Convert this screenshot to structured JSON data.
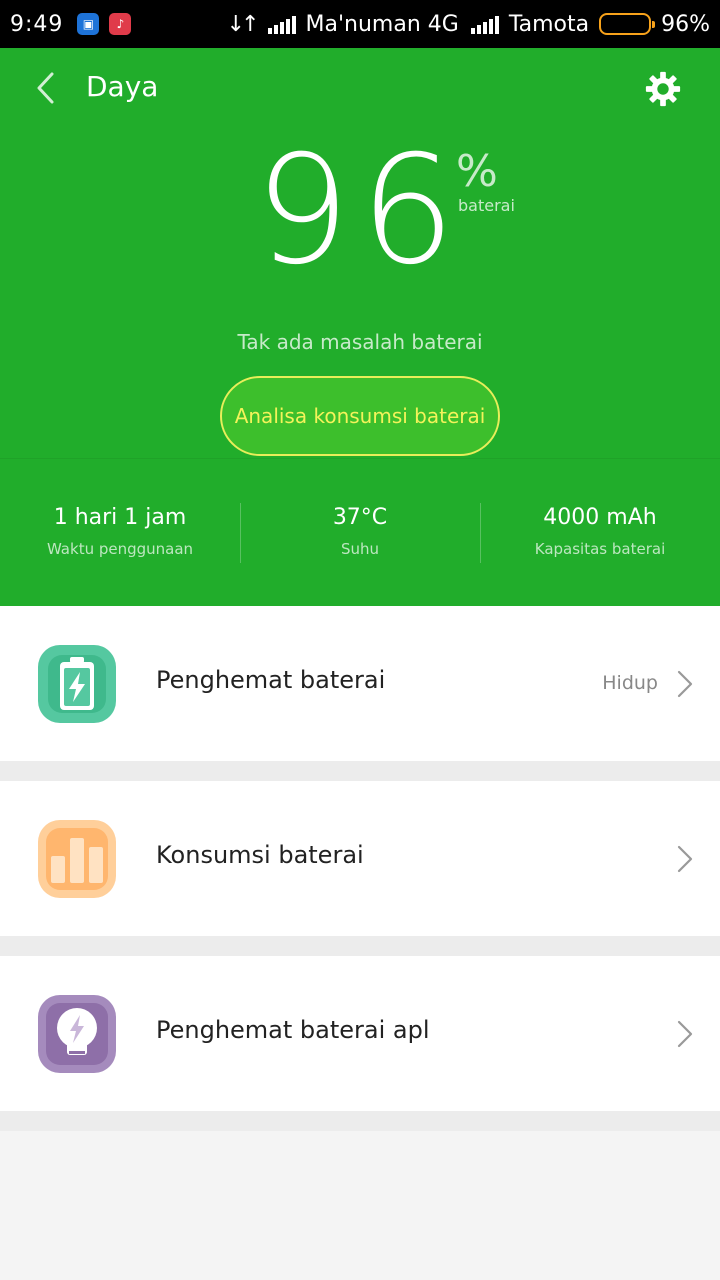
{
  "status_bar": {
    "time": "9:49",
    "carrier1": "Ma'numan 4G",
    "carrier2": "Tamota",
    "battery_pct": "96%",
    "battery_level": 0.96
  },
  "header": {
    "title": "Daya",
    "battery_number": "96",
    "percent_sign": "%",
    "percent_label": "baterai",
    "status_text": "Tak ada masalah baterai",
    "analyze_button": "Analisa konsumsi baterai"
  },
  "stats": [
    {
      "value": "1 hari 1 jam",
      "label": "Waktu penggunaan"
    },
    {
      "value": "37°C",
      "label": "Suhu"
    },
    {
      "value": "4000 mAh",
      "label": "Kapasitas baterai"
    }
  ],
  "list": [
    {
      "label": "Penghemat baterai",
      "value": "Hidup",
      "icon": "battery-saver-icon"
    },
    {
      "label": "Konsumsi baterai",
      "value": "",
      "icon": "bar-chart-icon"
    },
    {
      "label": "Penghemat baterai apl",
      "value": "",
      "icon": "bulb-icon"
    }
  ],
  "colors": {
    "header_green": "#21ad2b",
    "button_border": "#e8ee5a",
    "button_text": "#f3f35a",
    "battery_orange": "#f7a21b"
  }
}
